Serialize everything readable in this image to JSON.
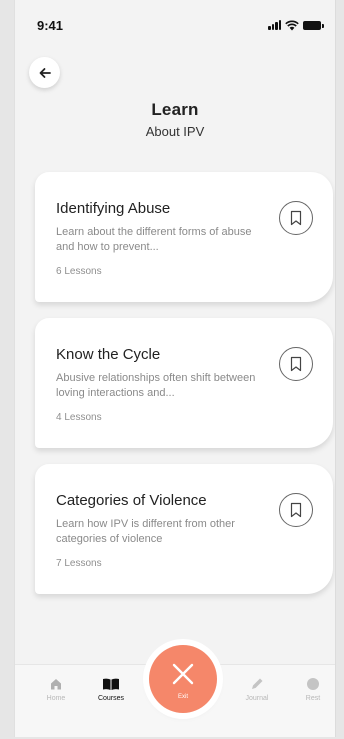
{
  "status": {
    "time": "9:41"
  },
  "header": {
    "title": "Learn",
    "subtitle": "About IPV"
  },
  "courses": [
    {
      "title": "Identifying Abuse",
      "description": "Learn about the different forms of abuse and how to prevent...",
      "lessons": "6 Lessons"
    },
    {
      "title": "Know the Cycle",
      "description": "Abusive relationships often shift between loving interactions and...",
      "lessons": "4 Lessons"
    },
    {
      "title": "Categories of Violence",
      "description": "Learn how IPV is different from other categories of violence",
      "lessons": "7 Lessons"
    }
  ],
  "nav": {
    "home": "Home",
    "courses": "Courses",
    "exit": "Exit",
    "journal": "Journal",
    "rest": "Rest"
  },
  "colors": {
    "accent": "#f5876a",
    "background": "#f3f3f3",
    "card": "#ffffff"
  },
  "icons": {
    "back": "arrow-left-icon",
    "bookmark": "bookmark-icon",
    "home": "home-icon",
    "courses": "book-icon",
    "exit": "close-icon",
    "journal": "pencil-icon",
    "rest": "circle-icon"
  }
}
